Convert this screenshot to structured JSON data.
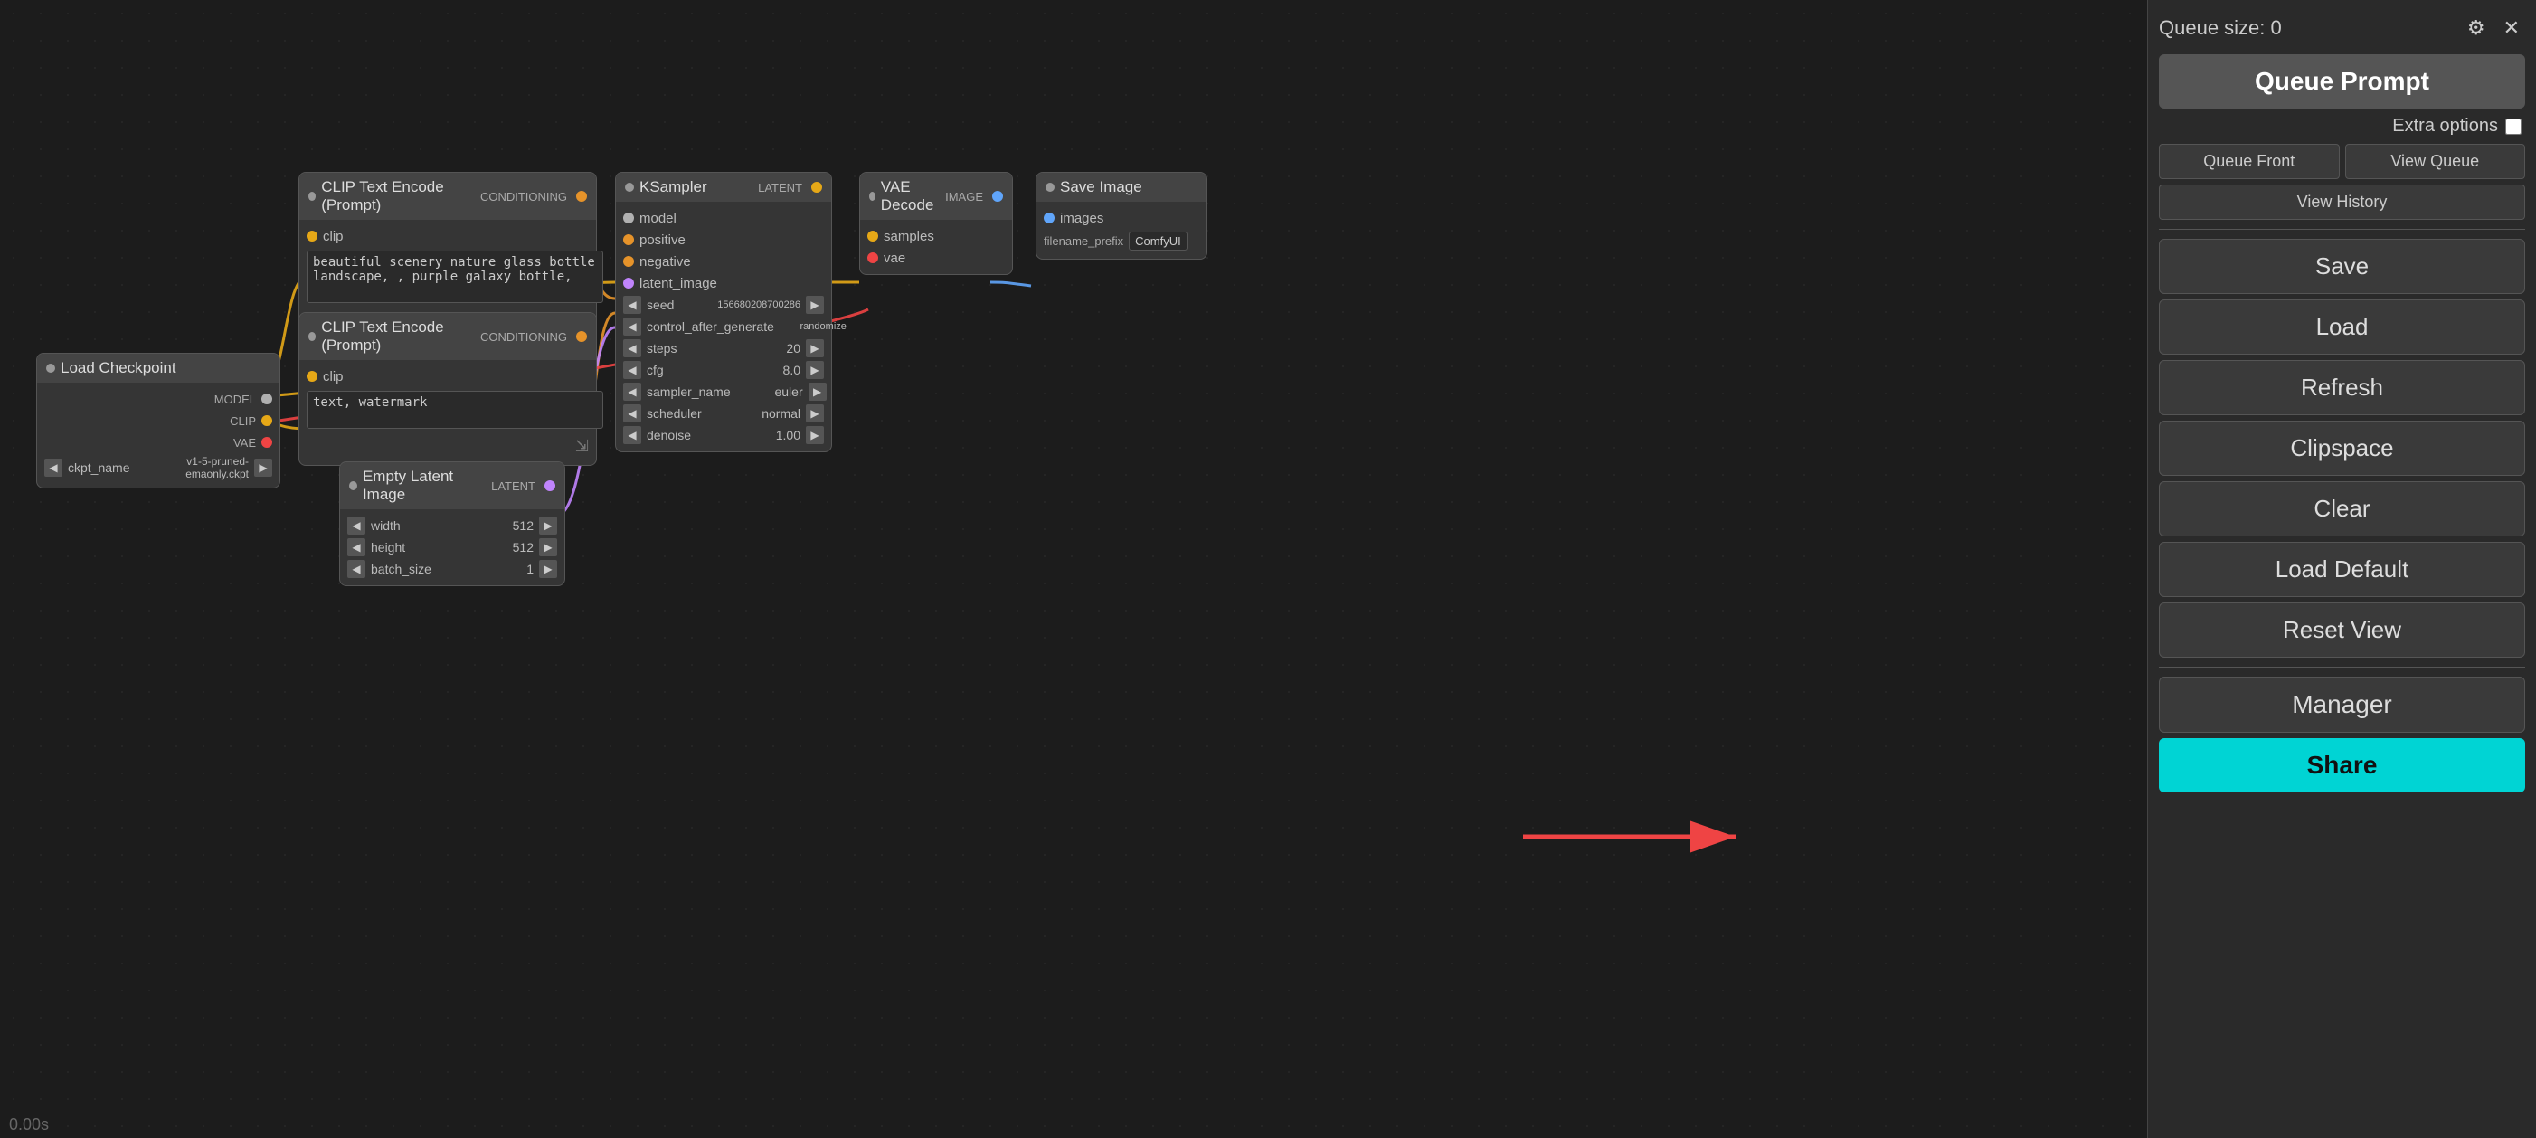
{
  "sidebar": {
    "queue_size_label": "Queue size: 0",
    "queue_prompt_label": "Queue Prompt",
    "extra_options_label": "Extra options",
    "queue_front_label": "Queue Front",
    "view_queue_label": "View Queue",
    "view_history_label": "View History",
    "save_label": "Save",
    "load_label": "Load",
    "refresh_label": "Refresh",
    "clipspace_label": "Clipspace",
    "clear_label": "Clear",
    "load_default_label": "Load Default",
    "reset_view_label": "Reset View",
    "manager_label": "Manager",
    "share_label": "Share"
  },
  "nodes": {
    "load_checkpoint": {
      "title": "Load Checkpoint",
      "outputs": [
        "MODEL",
        "CLIP",
        "VAE"
      ],
      "ckpt_name": "v1-5-pruned-emaonly.ckpt"
    },
    "clip_text_encode_1": {
      "title": "CLIP Text Encode (Prompt)",
      "input_port": "clip",
      "output_port": "CONDITIONING",
      "text": "beautiful scenery nature glass bottle landscape, , purple galaxy bottle,"
    },
    "clip_text_encode_2": {
      "title": "CLIP Text Encode (Prompt)",
      "input_port": "clip",
      "output_port": "CONDITIONING",
      "text": "text, watermark"
    },
    "ksampler": {
      "title": "KSampler",
      "inputs": [
        "model",
        "positive",
        "negative",
        "latent_image"
      ],
      "output": "LATENT",
      "seed": "156680208700286",
      "control_after_generate": "randomize",
      "steps": "20",
      "cfg": "8.0",
      "sampler_name": "euler",
      "scheduler": "normal",
      "denoise": "1.00"
    },
    "vae_decode": {
      "title": "VAE Decode",
      "inputs": [
        "samples",
        "vae"
      ],
      "output": "IMAGE"
    },
    "save_image": {
      "title": "Save Image",
      "input": "images",
      "filename_prefix_label": "filename_prefix",
      "filename_prefix_value": "ComfyUI"
    },
    "empty_latent_image": {
      "title": "Empty Latent Image",
      "output": "LATENT",
      "width": "512",
      "height": "512",
      "batch_size": "1"
    }
  },
  "status_bar": {
    "time": "0.00s"
  }
}
